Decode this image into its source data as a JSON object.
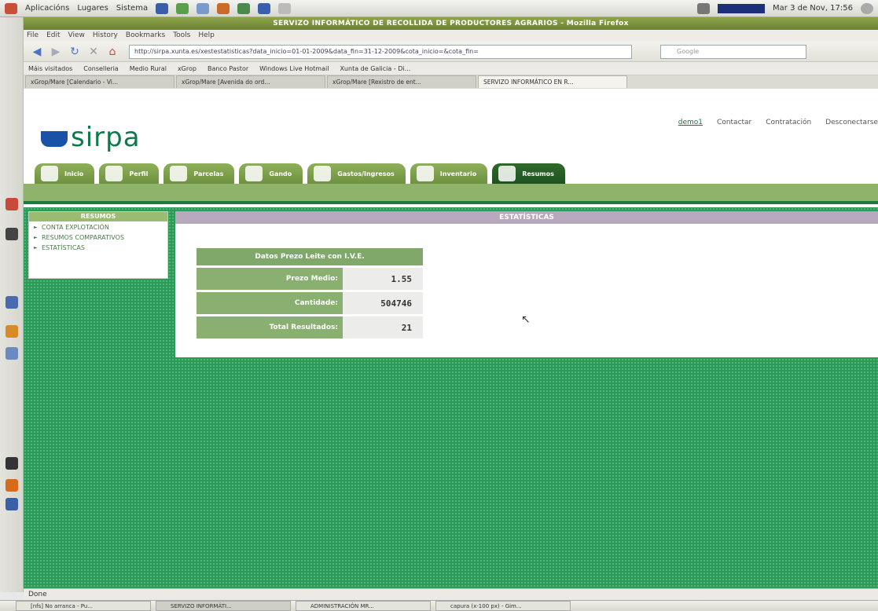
{
  "system_panel": {
    "menus": [
      "Aplicacións",
      "Lugares",
      "Sistema"
    ],
    "datetime": "Mar 3 de Nov, 17:56"
  },
  "window": {
    "title": "SERVIZO INFORMÁTICO DE RECOLLIDA DE PRODUCTORES AGRARIOS - Mozilla Firefox"
  },
  "browser": {
    "menu": [
      "File",
      "Edit",
      "View",
      "History",
      "Bookmarks",
      "Tools",
      "Help"
    ],
    "url": "http://sirpa.xunta.es/xestestatisticas?data_inicio=01-01-2009&data_fin=31-12-2009&cota_inicio=&cota_fin=",
    "search_placeholder": "Google",
    "bookmarks": [
      "Máis visitados",
      "Conselleria",
      "Medio Rural",
      "xGrop",
      "Banco Pastor",
      "Windows Live Hotmail",
      "Xunta de Galicia - Di..."
    ],
    "tabs": [
      {
        "label": "xGrop/Mare [Calendario - Vi...",
        "active": false
      },
      {
        "label": "xGrop/Mare [Avenida do ord...",
        "active": false
      },
      {
        "label": "xGrop/Mare [Rexistro de ent...",
        "active": false
      },
      {
        "label": "SERVIZO INFORMÁTICO EN R...",
        "active": true
      }
    ],
    "status": "Done"
  },
  "site": {
    "logo_text": "sirpa",
    "top_links": {
      "user": "demo1",
      "contact": "Contactar",
      "hiring": "Contratación",
      "logout": "Desconectarse"
    },
    "nav_tabs": [
      {
        "label": "Inicio",
        "active": false
      },
      {
        "label": "Perfil",
        "active": false
      },
      {
        "label": "Parcelas",
        "active": false
      },
      {
        "label": "Gando",
        "active": false
      },
      {
        "label": "Gastos/Ingresos",
        "active": false
      },
      {
        "label": "Inventario",
        "active": false
      },
      {
        "label": "Resumos",
        "active": true
      }
    ],
    "sidebar": {
      "title": "RESUMOS",
      "items": [
        "CONTA EXPLOTACIÓN",
        "RESUMOS COMPARATIVOS",
        "ESTATÍSTICAS"
      ]
    },
    "stats": {
      "panel_title": "ESTATÍSTICAS",
      "table_title": "Datos Prezo Leite con I.V.E.",
      "rows": [
        {
          "label": "Prezo Medio:",
          "value": "1.55"
        },
        {
          "label": "Cantidade:",
          "value": "504746"
        },
        {
          "label": "Total Resultados:",
          "value": "21"
        }
      ]
    }
  },
  "taskbar": {
    "items": [
      {
        "label": "[nfs] No arranca - Pu...",
        "active": false
      },
      {
        "label": "SERVIZO INFORMÁTI...",
        "active": true
      },
      {
        "label": "ADMINISTRACIÓN MR...",
        "active": false
      },
      {
        "label": "capura (x-100 px) - Gim...",
        "active": false
      }
    ]
  },
  "colors": {
    "brand_green": "#1e7a3c",
    "tab_green": "#6e9240",
    "active_tab": "#1f5220",
    "stats_header": "#b8a9bf"
  }
}
